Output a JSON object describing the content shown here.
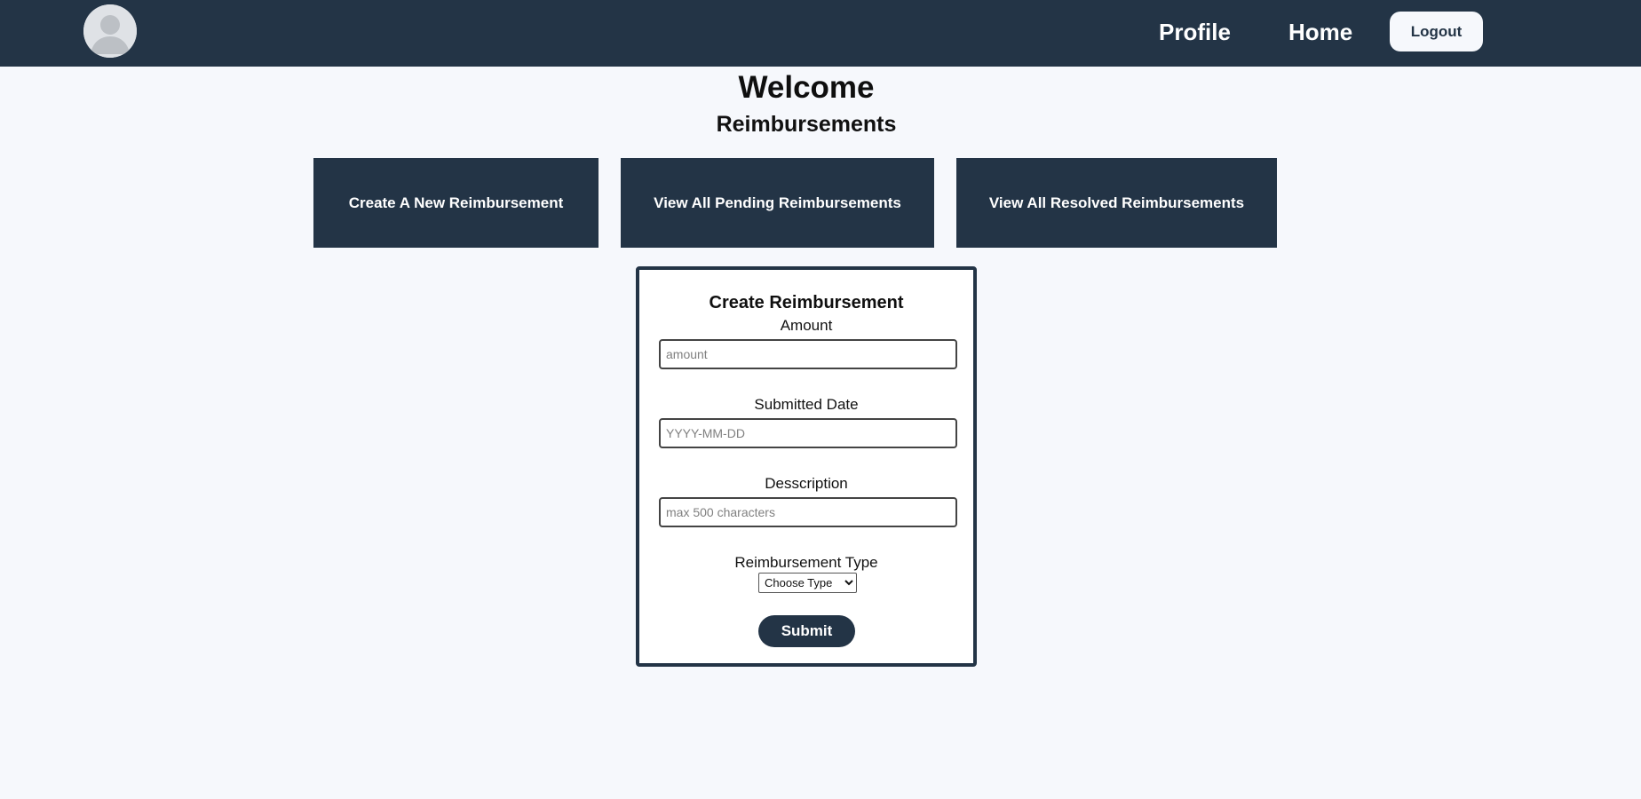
{
  "navbar": {
    "avatar_icon": "user-avatar-icon",
    "profile_label": "Profile",
    "home_label": "Home",
    "logout_label": "Logout",
    "background_color": "#233446"
  },
  "main": {
    "welcome": "Welcome",
    "section_title": "Reimbursements",
    "tiles": [
      {
        "label": "Create A New Reimbursement"
      },
      {
        "label": "View All Pending Reimbursements"
      },
      {
        "label": "View All Resolved Reimbursements"
      }
    ]
  },
  "form": {
    "title": "Create Reimbursement",
    "amount_label": "Amount",
    "amount_placeholder": "amount",
    "date_label": "Submitted Date",
    "date_placeholder": "YYYY-MM-DD",
    "description_label": "Desscription",
    "description_placeholder": "max 500 characters",
    "type_label": "Reimbursement Type",
    "type_selected": "Choose Type",
    "submit_label": "Submit"
  },
  "colors": {
    "primary": "#233446",
    "page_background": "#f6f8fc"
  }
}
